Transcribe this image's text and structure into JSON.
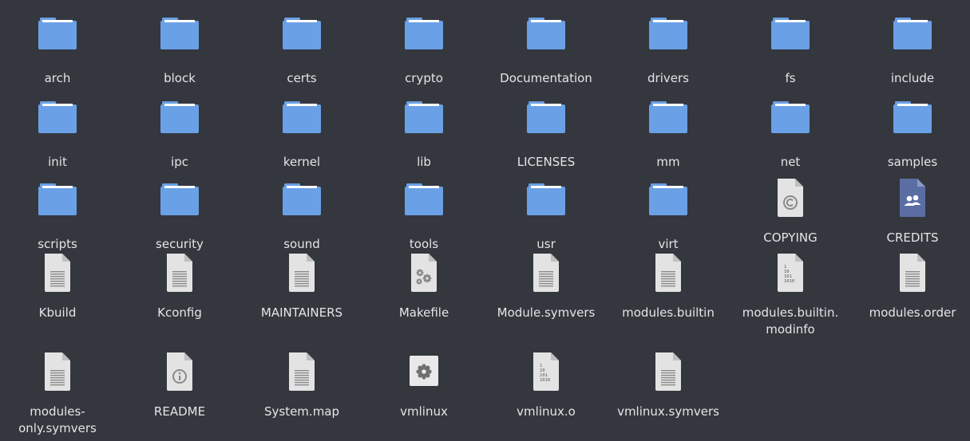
{
  "colors": {
    "background": "#34373e",
    "folder": "#6aa0e6",
    "folder_tab": "#ffffff",
    "file": "#e3e3e3",
    "file_fold": "#bfbfbf",
    "file_lines": "#8a8a8a",
    "credits": "#5a6ea3",
    "label": "#e4e5e8"
  },
  "items": [
    {
      "name": "arch",
      "icon": "folder-icon"
    },
    {
      "name": "block",
      "icon": "folder-icon"
    },
    {
      "name": "certs",
      "icon": "folder-icon"
    },
    {
      "name": "crypto",
      "icon": "folder-icon"
    },
    {
      "name": "Documentation",
      "icon": "folder-icon"
    },
    {
      "name": "drivers",
      "icon": "folder-icon"
    },
    {
      "name": "fs",
      "icon": "folder-icon"
    },
    {
      "name": "include",
      "icon": "folder-icon"
    },
    {
      "name": "init",
      "icon": "folder-icon"
    },
    {
      "name": "ipc",
      "icon": "folder-icon"
    },
    {
      "name": "kernel",
      "icon": "folder-icon"
    },
    {
      "name": "lib",
      "icon": "folder-icon"
    },
    {
      "name": "LICENSES",
      "icon": "folder-icon"
    },
    {
      "name": "mm",
      "icon": "folder-icon"
    },
    {
      "name": "net",
      "icon": "folder-icon"
    },
    {
      "name": "samples",
      "icon": "folder-icon"
    },
    {
      "name": "scripts",
      "icon": "folder-icon"
    },
    {
      "name": "security",
      "icon": "folder-icon"
    },
    {
      "name": "sound",
      "icon": "folder-icon"
    },
    {
      "name": "tools",
      "icon": "folder-icon"
    },
    {
      "name": "usr",
      "icon": "folder-icon"
    },
    {
      "name": "virt",
      "icon": "folder-icon"
    },
    {
      "name": "COPYING",
      "icon": "copyright-file-icon"
    },
    {
      "name": "CREDITS",
      "icon": "contacts-file-icon"
    },
    {
      "name": "Kbuild",
      "icon": "text-file-icon"
    },
    {
      "name": "Kconfig",
      "icon": "text-file-icon"
    },
    {
      "name": "MAINTAINERS",
      "icon": "text-file-icon"
    },
    {
      "name": "Makefile",
      "icon": "makefile-icon"
    },
    {
      "name": "Module.symvers",
      "icon": "text-file-icon"
    },
    {
      "name": "modules.builtin",
      "icon": "text-file-icon"
    },
    {
      "name": "modules.builtin.\nmodinfo",
      "icon": "binary-file-icon"
    },
    {
      "name": "modules.order",
      "icon": "text-file-icon"
    },
    {
      "name": "modules-\nonly.symvers",
      "icon": "text-file-icon"
    },
    {
      "name": "README",
      "icon": "info-file-icon"
    },
    {
      "name": "System.map",
      "icon": "text-file-icon"
    },
    {
      "name": "vmlinux",
      "icon": "executable-icon"
    },
    {
      "name": "vmlinux.o",
      "icon": "binary-file-icon"
    },
    {
      "name": "vmlinux.symvers",
      "icon": "text-file-icon"
    }
  ]
}
